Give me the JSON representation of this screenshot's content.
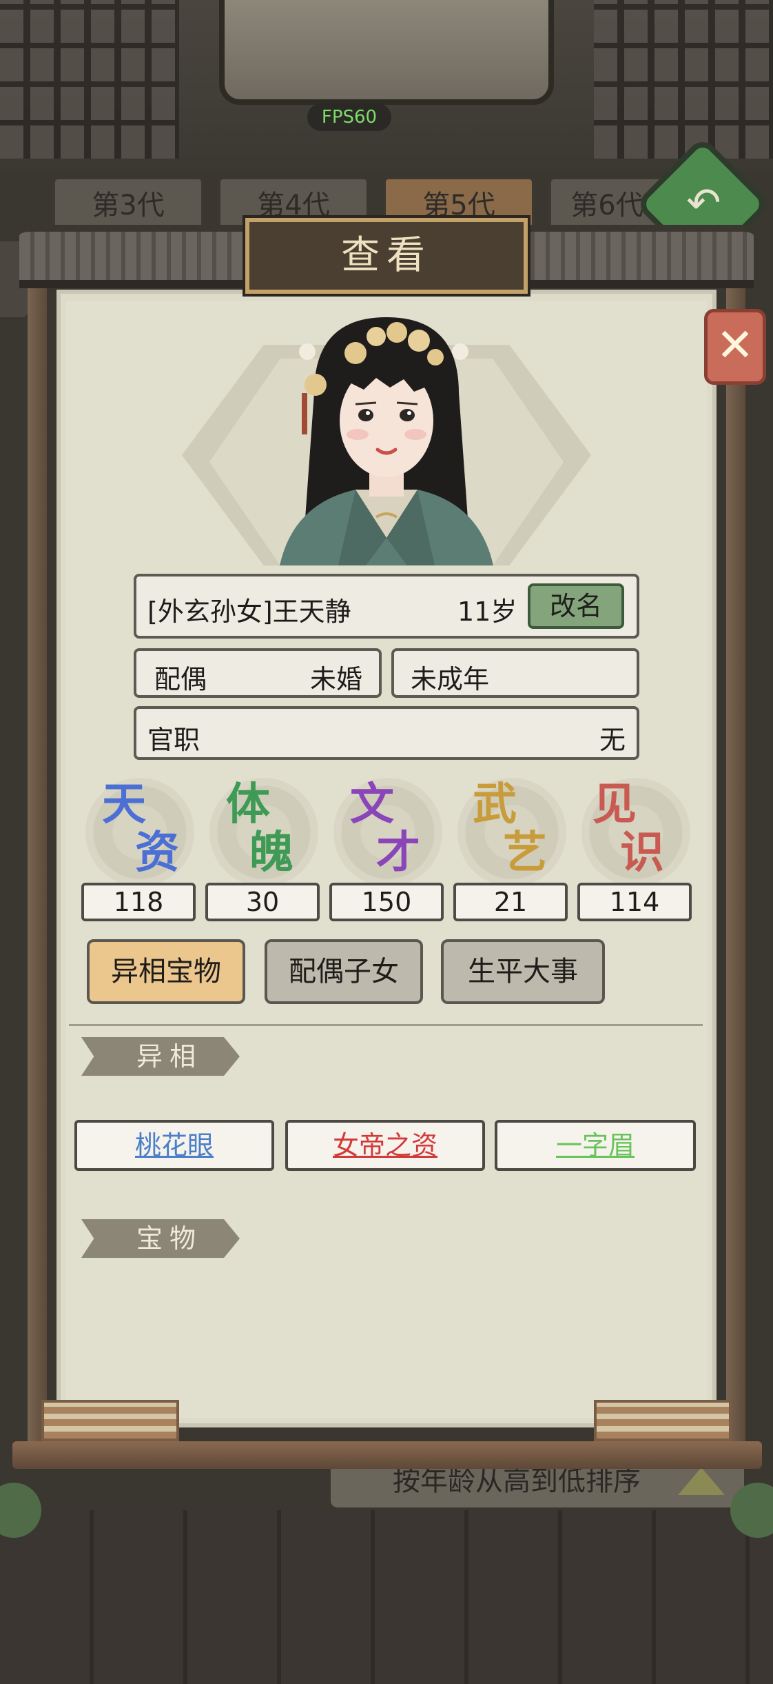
{
  "hud": {
    "fps": "FPS60"
  },
  "generation_tabs": [
    "第3代",
    "第4代",
    "第5代",
    "第6代"
  ],
  "sort_label": "按年龄从高到低排序",
  "panel": {
    "title": "查看",
    "close_icon": "close-x-icon"
  },
  "character": {
    "name": "[外玄孙女]王天静",
    "age": "11岁",
    "rename_label": "改名",
    "spouse_label": "配偶",
    "spouse_value": "未婚",
    "adult_status": "未成年",
    "office_label": "官职",
    "office_value": "无"
  },
  "stats": [
    {
      "chars": [
        "天",
        "资"
      ],
      "value": "118",
      "color": "#4b6fd4"
    },
    {
      "chars": [
        "体",
        "魄"
      ],
      "value": "30",
      "color": "#3e9a55"
    },
    {
      "chars": [
        "文",
        "才"
      ],
      "value": "150",
      "color": "#8a45b9"
    },
    {
      "chars": [
        "武",
        "艺"
      ],
      "value": "21",
      "color": "#c89c3a"
    },
    {
      "chars": [
        "见",
        "识"
      ],
      "value": "114",
      "color": "#c95a52"
    }
  ],
  "tabs": [
    {
      "label": "异相宝物",
      "active": true
    },
    {
      "label": "配偶子女",
      "active": false
    },
    {
      "label": "生平大事",
      "active": false
    }
  ],
  "sections": {
    "traits_title": "异相",
    "treasures_title": "宝物"
  },
  "traits": [
    {
      "label": "桃花眼",
      "color": "#4a7fc9"
    },
    {
      "label": "女帝之资",
      "color": "#d23a3a"
    },
    {
      "label": "一字眉",
      "color": "#69c35c"
    }
  ]
}
